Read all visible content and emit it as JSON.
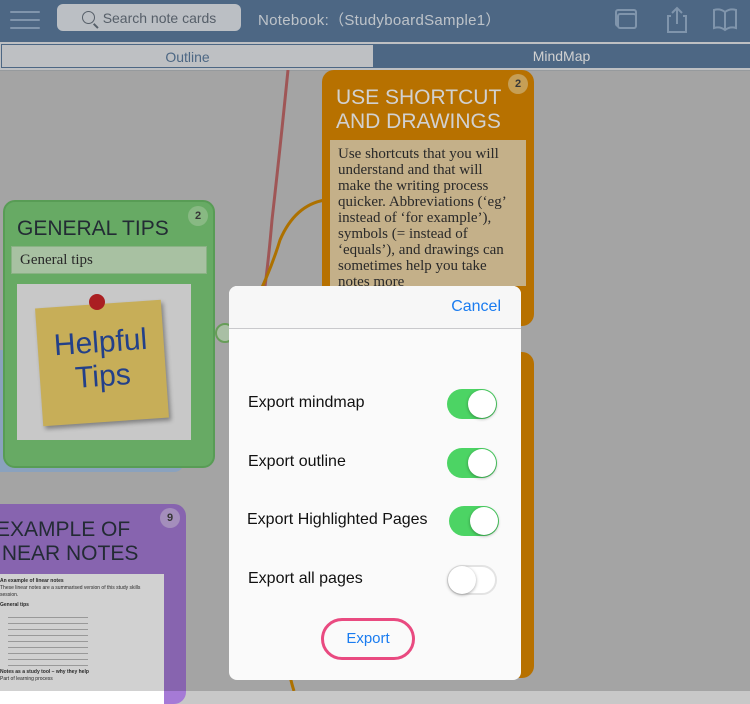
{
  "toolbar": {
    "search_placeholder": "Search note cards",
    "notebook_title": "Notebook:（StudyboardSample1）"
  },
  "view_tabs": {
    "outline": "Outline",
    "mindmap": "MindMap",
    "selected": "MindMap"
  },
  "cards": {
    "shortcut": {
      "title_line1": "USE SHORTCUT",
      "title_line2": "AND DRAWINGS",
      "badge": "2",
      "note": "Use shortcuts that you will understand and that will make the writing process quicker.  Abbreviations (‘eg’ instead of ‘for example’), symbols (= instead of ‘equals’), and drawings can sometimes help you take notes more"
    },
    "general": {
      "title": "GENERAL TIPS",
      "badge": "2",
      "subtitle": "General tips",
      "image_line1": "Helpful",
      "image_line2": "Tips"
    },
    "linear": {
      "title_line1": "EXAMPLE OF",
      "title_line2": "INEAR NOTES",
      "badge": "9",
      "doc_heading": "An example of linear notes",
      "doc_intro": "These linear notes are a summarised version of this study skills session.",
      "doc_section": "General tips",
      "doc_footer": "Notes as a study tool – why they help",
      "doc_last": "Part of learning process"
    }
  },
  "dialog": {
    "cancel_label": "Cancel",
    "options": [
      {
        "label": "Export mindmap",
        "enabled": true
      },
      {
        "label": "Export outline",
        "enabled": true
      },
      {
        "label": "Export Highlighted Pages",
        "enabled": true
      },
      {
        "label": "Export all pages",
        "enabled": false
      }
    ],
    "export_label": "Export"
  },
  "colors": {
    "toolbar": "#5e7ea1",
    "orange_card": "#e08a00",
    "green_card": "#7ed07a",
    "purple_card": "#a57ad6",
    "switch_on": "#4cd464",
    "link_blue": "#1a7cf0",
    "highlight_ring": "#e94a80"
  }
}
